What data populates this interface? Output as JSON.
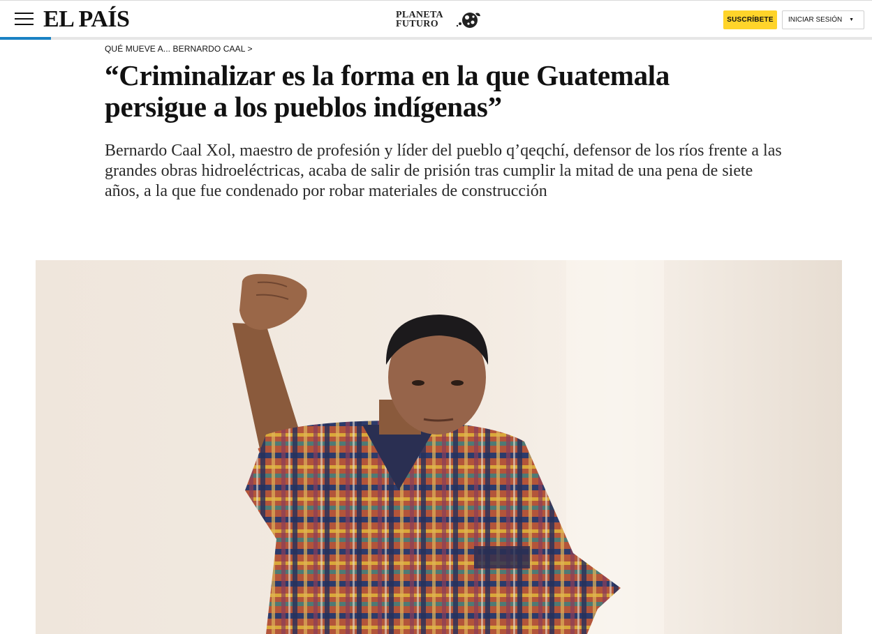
{
  "header": {
    "menu_icon": "hamburger-menu-icon",
    "logo": "EL PAÍS",
    "section_logo_line1": "PLANETA",
    "section_logo_line2": "FUTURO",
    "section_logo_icon": "globe-leaf-icon",
    "subscribe_label": "SUSCRÍBETE",
    "login_label": "INICIAR SESIÓN",
    "login_caret": "▼"
  },
  "colors": {
    "accent_yellow": "#ffd42a",
    "progress_blue": "#1a82c4",
    "text": "#111111"
  },
  "article": {
    "breadcrumb": "QUÉ MUEVE A... BERNARDO CAAL >",
    "headline": "“Criminalizar es la forma en la que Guatemala persigue a los pueblos indígenas”",
    "standfirst": "Bernardo Caal Xol, maestro de profesión y líder del pueblo q’qeqchí, defensor de los ríos frente a las grandes obras hidroeléctricas, acaba de salir de prisión tras cumplir la mitad de una pena de siete años, a la que fue condenado por robar materiales de construcción",
    "image_subject": "man-with-raised-fist-photo"
  }
}
